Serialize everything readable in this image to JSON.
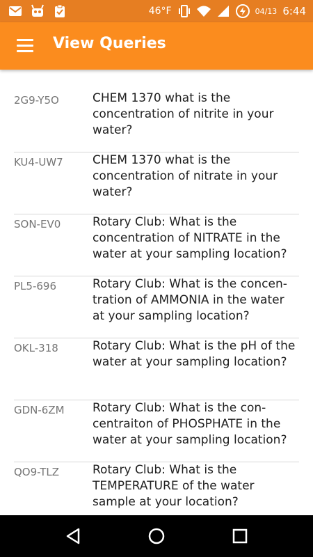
{
  "status_bar": {
    "icons_left": [
      "gmail-icon",
      "android-debug-icon",
      "clipboard-check-icon"
    ],
    "temperature": "46°F",
    "date": "04/13",
    "time": "6:44"
  },
  "app_bar": {
    "title": "View Queries"
  },
  "queries": [
    {
      "code": "2G9-Y5O",
      "text": "CHEM 1370 what is the concentration of nitrite in your water?"
    },
    {
      "code": "KU4-UW7",
      "text": "CHEM 1370 what is the concentration of nitrate in your water?"
    },
    {
      "code": "SON-EV0",
      "text": "Rotary Club: What is the concentration of NITRATE in the water at your sampling location?"
    },
    {
      "code": "PL5-696",
      "text": "Rotary Club: What is the concen-tration of AMMONIA in the water at your sampling location?"
    },
    {
      "code": "OKL-318",
      "text": "Rotary Club: What is the pH of the water at your sampling location?"
    },
    {
      "code": "GDN-6ZM",
      "text": "Rotary Club: What is the con-centraiton of PHOSPHATE in the water at your sampling location?"
    },
    {
      "code": "QO9-TLZ",
      "text": "Rotary Club: What is the TEMPERATURE of the water sample at your location?"
    }
  ],
  "colors": {
    "status_bar": "#e67e22",
    "app_bar": "#fb8c1e",
    "nav_bar": "#000000"
  }
}
